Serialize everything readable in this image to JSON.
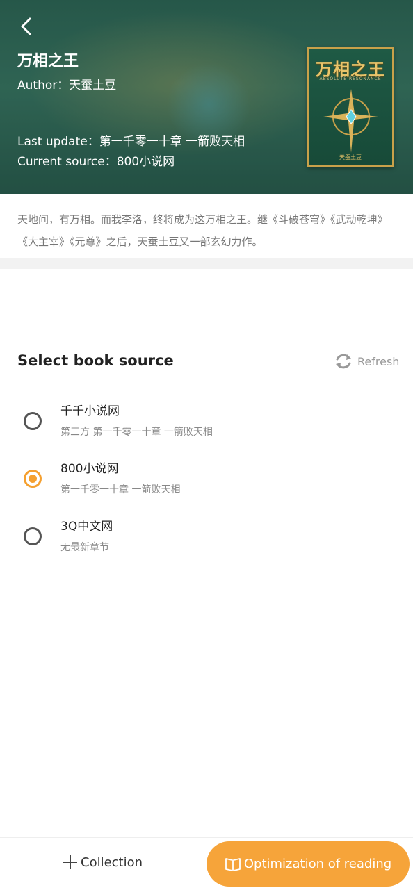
{
  "header": {
    "back_icon": "chevron-left-icon",
    "title": "万相之王",
    "author": "Author：天蚕土豆",
    "last_update": "Last update：第一千零一十章 一箭败天相",
    "current_source": "Current source：800小说网",
    "cover": {
      "title": "万相之王",
      "subtitle": "ABSOLUTE RESONANCE",
      "author": "天蚕土豆"
    }
  },
  "description": "天地间，有万相。而我李洛，终将成为这万相之王。继《斗破苍穹》《武动乾坤》《大主宰》《元尊》之后，天蚕土豆又一部玄幻力作。",
  "source_section": {
    "title": "Select book source",
    "refresh_label": "Refresh",
    "refresh_icon": "refresh-icon",
    "sources": [
      {
        "name": "千千小说网",
        "latest": "第三方 第一千零一十章 一箭败天相",
        "selected": false
      },
      {
        "name": "800小说网",
        "latest": "第一千零一十章 一箭败天相",
        "selected": true
      },
      {
        "name": "3Q中文网",
        "latest": "无最新章节",
        "selected": false
      }
    ]
  },
  "bottom_bar": {
    "collection_label": "Collection",
    "collection_icon": "plus-icon",
    "read_label": "Optimization of reading",
    "read_icon": "book-icon"
  },
  "colors": {
    "accent": "#f6a43a",
    "header_bg": "#3a7a66"
  }
}
